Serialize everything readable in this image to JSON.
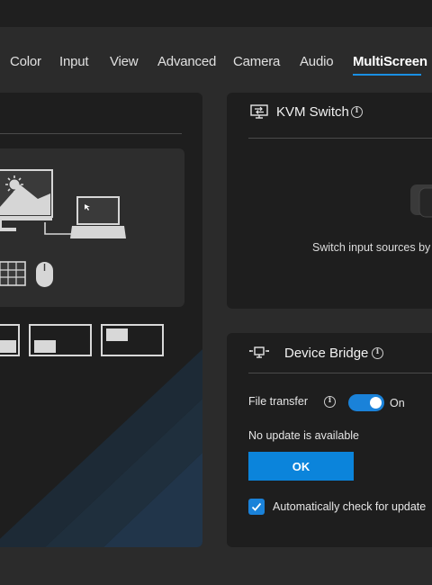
{
  "tabs": [
    {
      "label": "Color"
    },
    {
      "label": "Input"
    },
    {
      "label": "View"
    },
    {
      "label": "Advanced"
    },
    {
      "label": "Camera"
    },
    {
      "label": "Audio"
    },
    {
      "label": "MultiScreen",
      "active": true
    }
  ],
  "kvm": {
    "title": "KVM Switch",
    "icon": "monitor-switch-icon",
    "description": "Switch input sources by"
  },
  "device_bridge": {
    "title": "Device Bridge",
    "icon": "device-bridge-icon",
    "file_transfer_label": "File transfer",
    "file_transfer_state": "On",
    "update_status": "No update is available",
    "ok_label": "OK",
    "auto_check_label": "Automatically check for update",
    "auto_check_checked": true
  },
  "colors": {
    "accent": "#1a82d9",
    "tab_underline": "#1a8fe3",
    "card_bg": "#1e1e1e",
    "page_bg": "#2b2b2b"
  }
}
